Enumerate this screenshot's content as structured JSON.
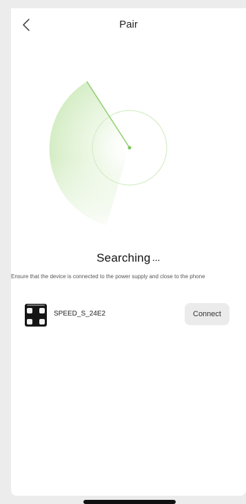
{
  "header": {
    "title": "Pair",
    "back_icon": "chevron-left-icon"
  },
  "radar": {
    "accent_color": "#8fcf6e",
    "sweep_color": "#a7d98a"
  },
  "status": {
    "label": "Searching",
    "dots": "..."
  },
  "hint": "Ensure that the device is connected to the power supply and close to the phone",
  "devices": [
    {
      "icon": "smart-scale-icon",
      "name": "SPEED_S_24E2",
      "action_label": "Connect"
    }
  ]
}
